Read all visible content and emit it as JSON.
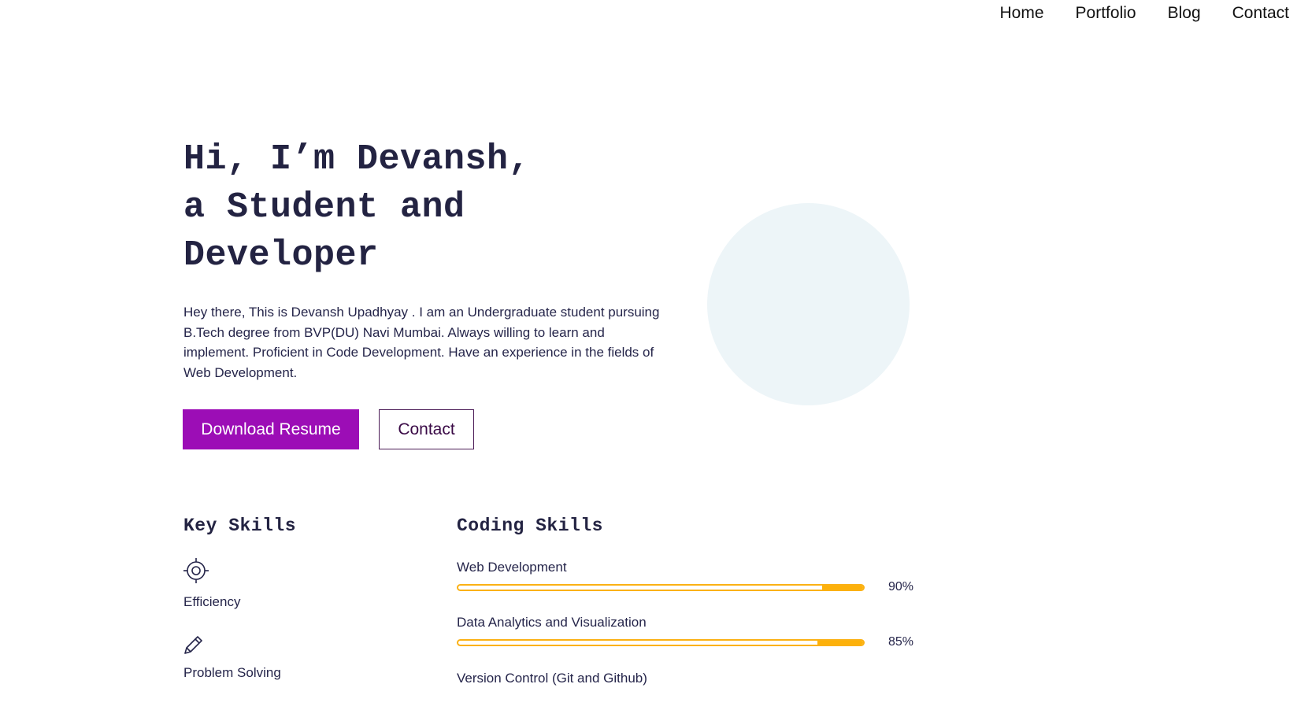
{
  "nav": {
    "items": [
      "Home",
      "Portfolio",
      "Blog",
      "Contact"
    ]
  },
  "hero": {
    "title_lines": [
      "Hi, I’m Devansh,",
      "a Student and",
      "Developer"
    ],
    "intro": "Hey there, This is Devansh Upadhyay . I am an Undergraduate student pursuing B.Tech degree from BVP(DU) Navi Mumbai. Always willing to learn and implement. Proficient in Code Development. Have an experience in the fields of Web Development.",
    "primary_button": "Download Resume",
    "secondary_button": "Contact"
  },
  "key_skills": {
    "heading": "Key Skills",
    "items": [
      {
        "label": "Efficiency",
        "icon": "target-icon"
      },
      {
        "label": "Problem Solving",
        "icon": "pencil-icon"
      }
    ]
  },
  "coding_skills": {
    "heading": "Coding Skills",
    "items": [
      {
        "name": "Web Development",
        "percent_label": "90%",
        "percent": 90
      },
      {
        "name": "Data Analytics and Visualization",
        "percent_label": "85%",
        "percent": 85
      },
      {
        "name": "Version Control (Git and Github)"
      }
    ]
  },
  "colors": {
    "primary_button": "#9c0db6",
    "accent_bar": "#fdb10a",
    "circle": "#edf5f8",
    "text": "#232342"
  }
}
